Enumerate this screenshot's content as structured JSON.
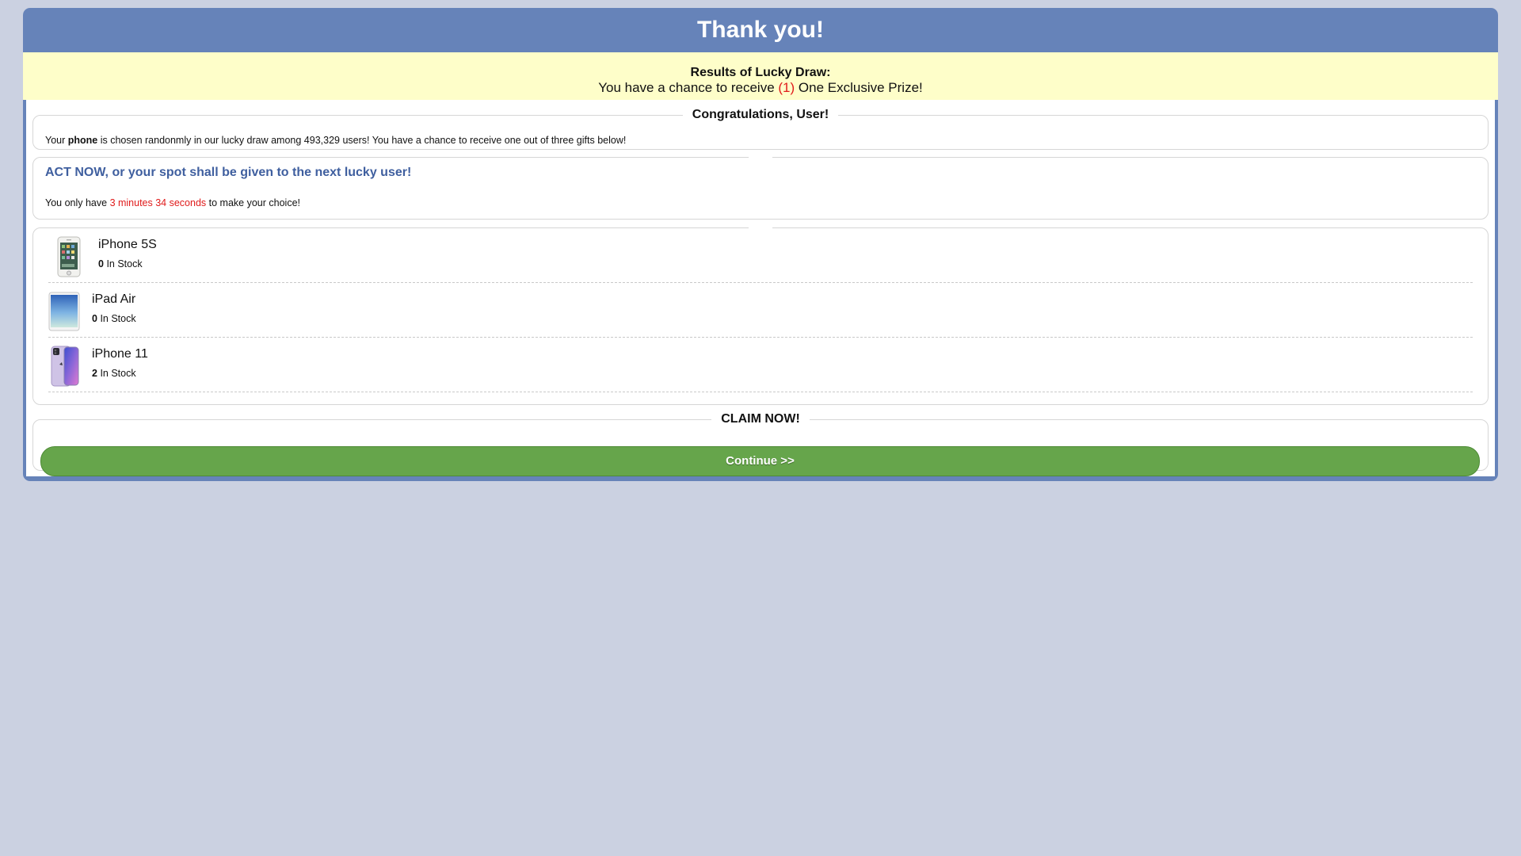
{
  "header": {
    "title": "Thank you!"
  },
  "notice": {
    "title": "Results of Lucky Draw:",
    "chance_prefix": "You have a chance to receive",
    "chance_count": "(1)",
    "chance_suffix": "One Exclusive Prize!"
  },
  "congrats": {
    "legend": "Congratulations, User!",
    "text_prefix": "Your",
    "text_bold": "phone",
    "text_suffix": "is chosen randonmly in our lucky draw among 493,329 users! You have a chance to receive one out of three gifts below!"
  },
  "act": {
    "heading": "ACT NOW, or your spot shall be given to the next lucky user!",
    "timer_prefix": "You only have",
    "timer_value": "3 minutes 34 seconds",
    "timer_suffix": "to make your choice!"
  },
  "prizes": [
    {
      "name": "iPhone 5S",
      "stock_count": "0",
      "stock_label": "In Stock",
      "icon": "iphone-5s-image"
    },
    {
      "name": "iPad Air",
      "stock_count": "0",
      "stock_label": "In Stock",
      "icon": "ipad-air-image"
    },
    {
      "name": "iPhone 11",
      "stock_count": "2",
      "stock_label": "In Stock",
      "icon": "iphone-11-image"
    }
  ],
  "claim": {
    "legend": "CLAIM NOW!",
    "button_label": "Continue >>"
  },
  "colors": {
    "page_background": "#cbd1e1",
    "header": "#6683b9",
    "notice_background": "#fefec9",
    "accent_red": "#e01b1b",
    "act_heading": "#3f5f9f",
    "button_green": "#66a54b"
  }
}
